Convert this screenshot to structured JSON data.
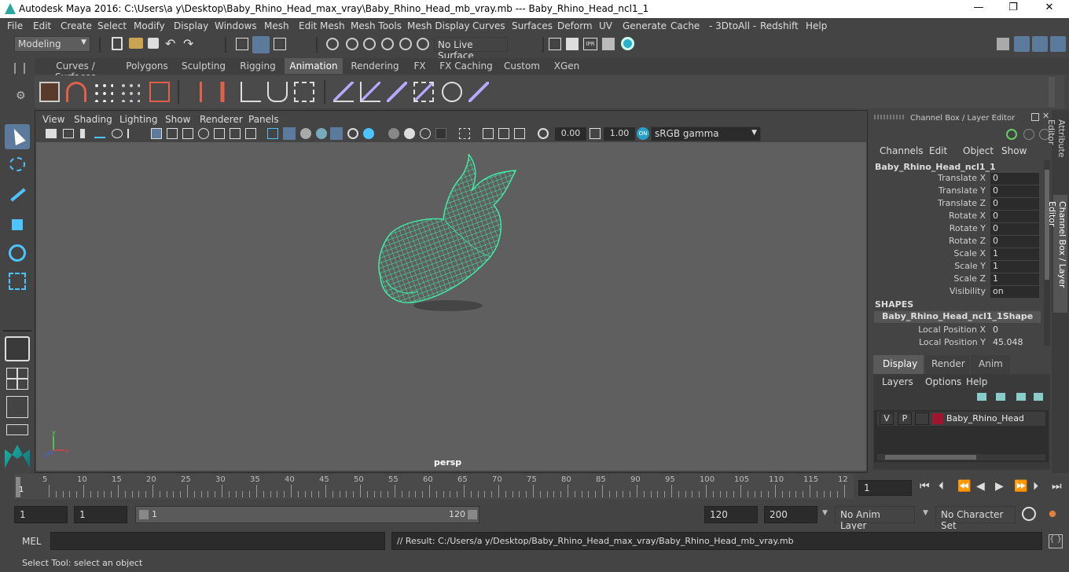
{
  "window": {
    "title": "Autodesk Maya 2016: C:\\Users\\a y\\Desktop\\Baby_Rhino_Head_max_vray\\Baby_Rhino_Head_mb_vray.mb   ---   Baby_Rhino_Head_ncl1_1",
    "min": "—",
    "max": "❐",
    "close": "✕"
  },
  "menu": [
    "File",
    "Edit",
    "Create",
    "Select",
    "Modify",
    "Display",
    "Windows",
    "Mesh",
    "Edit Mesh",
    "Mesh Tools",
    "Mesh Display",
    "Curves",
    "Surfaces",
    "Deform",
    "UV",
    "Generate",
    "Cache",
    "- 3DtoAll -",
    "Redshift",
    "Help"
  ],
  "status": {
    "mode": "Modeling",
    "live_surface": "No Live Surface"
  },
  "shelf": {
    "tabs": [
      "Curves / Surfaces",
      "Polygons",
      "Sculpting",
      "Rigging",
      "Animation",
      "Rendering",
      "FX",
      "FX Caching",
      "Custom",
      "XGen"
    ],
    "active_tab": "Animation"
  },
  "viewport": {
    "menu": [
      "View",
      "Shading",
      "Lighting",
      "Show",
      "Renderer",
      "Panels"
    ],
    "exposure": "0.00",
    "gamma": "1.00",
    "color_space": "sRGB gamma",
    "camera": "persp",
    "mesh_color": "#3ff0a8"
  },
  "channel_box": {
    "header": "Channel Box / Layer Editor",
    "menu": [
      "Channels",
      "Edit",
      "Object",
      "Show"
    ],
    "object": "Baby_Rhino_Head_ncl1_1",
    "attributes": [
      {
        "label": "Translate X",
        "value": "0"
      },
      {
        "label": "Translate Y",
        "value": "0"
      },
      {
        "label": "Translate Z",
        "value": "0"
      },
      {
        "label": "Rotate X",
        "value": "0"
      },
      {
        "label": "Rotate Y",
        "value": "0"
      },
      {
        "label": "Rotate Z",
        "value": "0"
      },
      {
        "label": "Scale X",
        "value": "1"
      },
      {
        "label": "Scale Y",
        "value": "1"
      },
      {
        "label": "Scale Z",
        "value": "1"
      },
      {
        "label": "Visibility",
        "value": "on"
      }
    ],
    "shapes_title": "SHAPES",
    "shape_name": "Baby_Rhino_Head_ncl1_1Shape",
    "shape_attrs": [
      {
        "label": "Local Position X",
        "value": "0"
      },
      {
        "label": "Local Position Y",
        "value": "45.048"
      }
    ],
    "layer_tabs": [
      "Display",
      "Render",
      "Anim"
    ],
    "layer_menu": [
      "Layers",
      "Options",
      "Help"
    ],
    "layer": {
      "v": "V",
      "p": "P",
      "name": "Baby_Rhino_Head",
      "color": "#a0152f"
    },
    "side_tabs": [
      "Attribute Editor",
      "Channel Box / Layer Editor"
    ]
  },
  "timeline": {
    "ticks": [
      "5",
      "10",
      "15",
      "20",
      "25",
      "30",
      "35",
      "40",
      "45",
      "50",
      "55",
      "60",
      "65",
      "70",
      "75",
      "80",
      "85",
      "90",
      "95",
      "100",
      "105",
      "110",
      "115",
      "12"
    ],
    "current_frame": "1",
    "current_field": "1"
  },
  "range": {
    "start": "1",
    "playback_start": "1",
    "slider_start": "1",
    "slider_end": "120",
    "playback_end": "120",
    "end": "200",
    "anim_layer": "No Anim Layer",
    "char_set": "No Character Set"
  },
  "command": {
    "mel_label": "MEL",
    "result": "// Result: C:/Users/a y/Desktop/Baby_Rhino_Head_max_vray/Baby_Rhino_Head_mb_vray.mb"
  },
  "help_line": "Select Tool: select an object"
}
